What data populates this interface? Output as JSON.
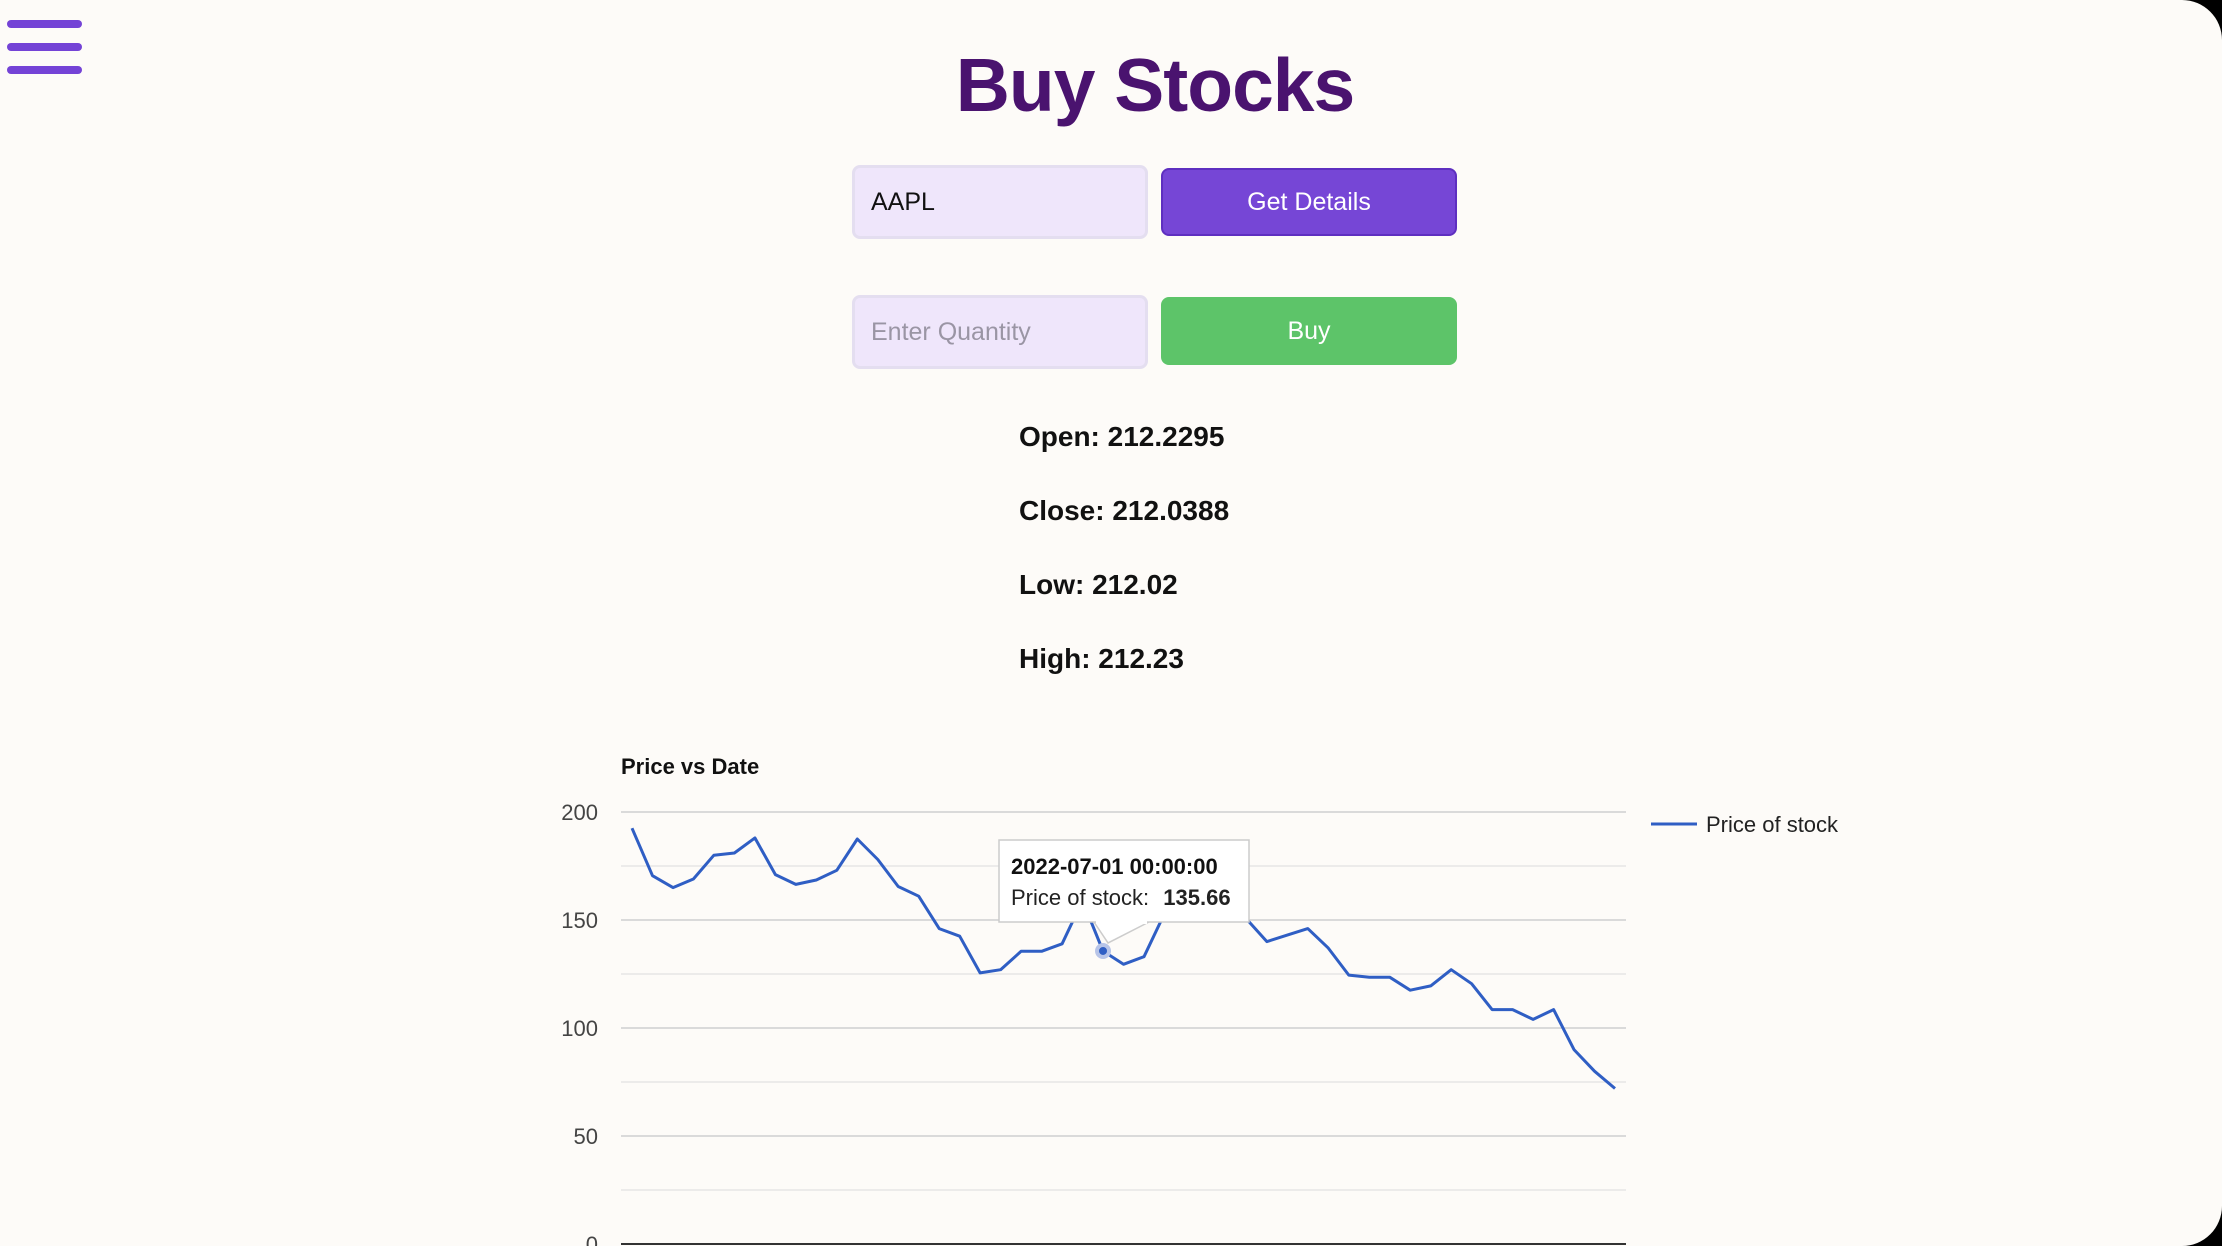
{
  "page": {
    "title": "Buy Stocks"
  },
  "nav": {
    "menu_icon": "hamburger-menu-icon"
  },
  "ticker_form": {
    "value": "AAPL",
    "placeholder": "",
    "button_label": "Get Details"
  },
  "buy_form": {
    "value": "",
    "placeholder": "Enter Quantity",
    "button_label": "Buy"
  },
  "stats": {
    "open": "Open: 212.2295",
    "close": "Close: 212.0388",
    "low": "Low: 212.02",
    "high": "High: 212.23"
  },
  "colors": {
    "title": "#4a136f",
    "accent": "#7646d6",
    "buy": "#5dc469",
    "line": "#2f5ec4",
    "background": "#fdfbf8"
  },
  "chart_data": {
    "type": "line",
    "title": "Price vs Date",
    "xlabel": "",
    "ylabel": "",
    "ylim": [
      0,
      200
    ],
    "yticks": [
      0,
      50,
      100,
      150,
      200
    ],
    "grid": true,
    "legend_position": "right",
    "series": [
      {
        "name": "Price of stock",
        "color": "#2f5ec4",
        "values": [
          192.5,
          170.5,
          165,
          169,
          180,
          181,
          188,
          171,
          166.5,
          168.5,
          173,
          187.5,
          178,
          165.5,
          161,
          146,
          142.5,
          125.5,
          127,
          135.5,
          135.5,
          139,
          159,
          135.66,
          129.5,
          133,
          153,
          161,
          162,
          156,
          150.5,
          140,
          143,
          146,
          137,
          124.5,
          123.5,
          123.5,
          117.5,
          119.5,
          127,
          120.5,
          108.5,
          108.5,
          104,
          108.5,
          90,
          80,
          72
        ]
      }
    ],
    "tooltip": {
      "date": "2022-07-01 00:00:00",
      "series_label": "Price of stock:",
      "value": "135.66",
      "point_index": 23
    }
  }
}
